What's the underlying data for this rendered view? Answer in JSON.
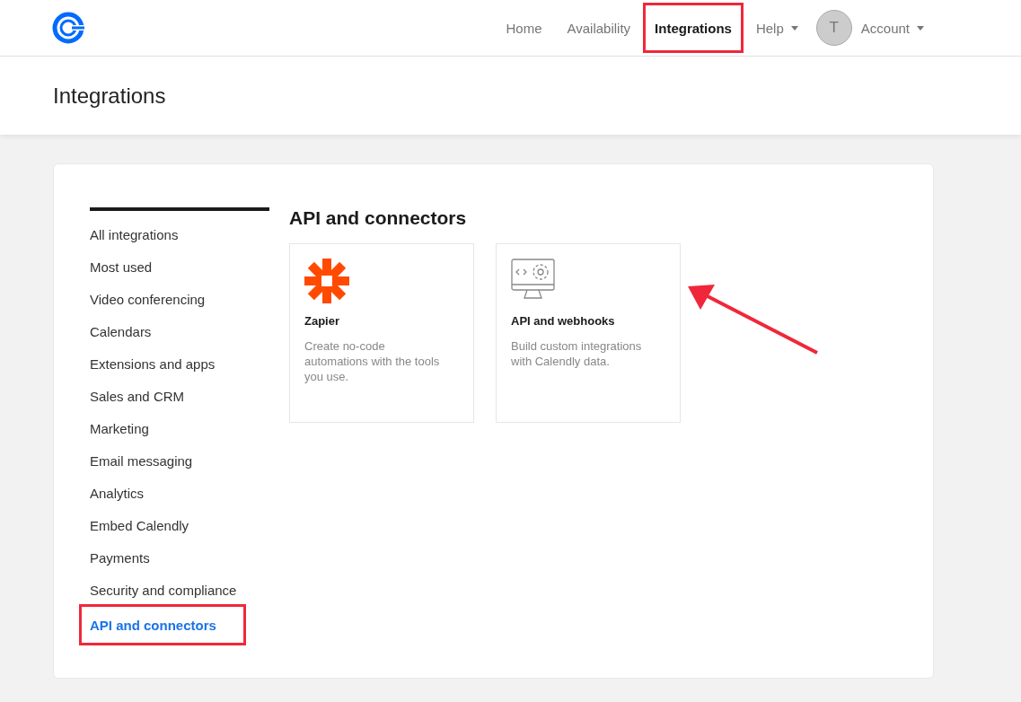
{
  "nav": {
    "items": [
      {
        "label": "Home",
        "selected": false,
        "highlighted": false,
        "dropdown": false
      },
      {
        "label": "Availability",
        "selected": false,
        "highlighted": false,
        "dropdown": false
      },
      {
        "label": "Integrations",
        "selected": true,
        "highlighted": true,
        "dropdown": false
      },
      {
        "label": "Help",
        "selected": false,
        "highlighted": false,
        "dropdown": true
      }
    ],
    "account": {
      "initial": "T",
      "label": "Account"
    }
  },
  "page_title": "Integrations",
  "sidebar": {
    "items": [
      {
        "label": "All integrations",
        "selected": false,
        "highlighted": false
      },
      {
        "label": "Most used",
        "selected": false,
        "highlighted": false
      },
      {
        "label": "Video conferencing",
        "selected": false,
        "highlighted": false
      },
      {
        "label": "Calendars",
        "selected": false,
        "highlighted": false
      },
      {
        "label": "Extensions and apps",
        "selected": false,
        "highlighted": false
      },
      {
        "label": "Sales and CRM",
        "selected": false,
        "highlighted": false
      },
      {
        "label": "Marketing",
        "selected": false,
        "highlighted": false
      },
      {
        "label": "Email messaging",
        "selected": false,
        "highlighted": false
      },
      {
        "label": "Analytics",
        "selected": false,
        "highlighted": false
      },
      {
        "label": "Embed Calendly",
        "selected": false,
        "highlighted": false
      },
      {
        "label": "Payments",
        "selected": false,
        "highlighted": false
      },
      {
        "label": "Security and compliance",
        "selected": false,
        "highlighted": false
      },
      {
        "label": "API and connectors",
        "selected": true,
        "highlighted": true
      }
    ]
  },
  "section": {
    "heading": "API and connectors",
    "cards": [
      {
        "kind": "zapier",
        "title": "Zapier",
        "description": "Create no-code automations with the tools you use."
      },
      {
        "kind": "api",
        "title": "API and webhooks",
        "description": "Build custom integrations with Calendly data.",
        "pointed_at": true
      }
    ]
  }
}
